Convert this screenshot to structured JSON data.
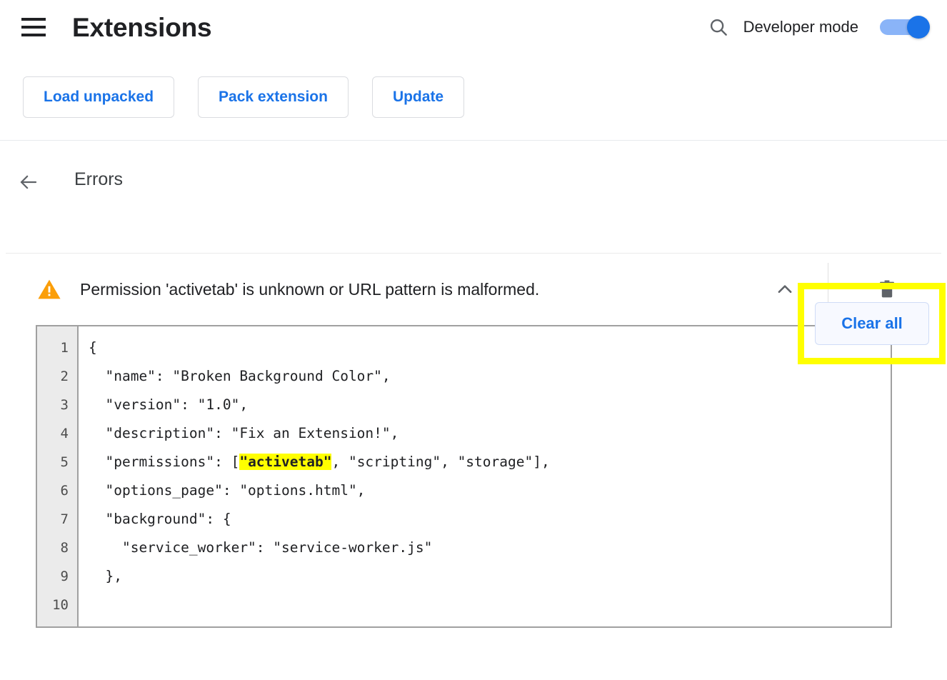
{
  "header": {
    "menu_icon": "hamburger-menu-icon",
    "title": "Extensions",
    "search_icon": "search-icon",
    "developer_mode_label": "Developer mode",
    "developer_mode_on": true
  },
  "toolbar": {
    "buttons": [
      {
        "label": "Load unpacked",
        "name": "load-unpacked-button"
      },
      {
        "label": "Pack extension",
        "name": "pack-extension-button"
      },
      {
        "label": "Update",
        "name": "update-button"
      }
    ]
  },
  "errors_page": {
    "back_icon": "arrow-left-icon",
    "title": "Errors",
    "clear_all_label": "Clear all",
    "highlight_color": "#ffff00"
  },
  "error_item": {
    "severity_icon": "warning-triangle-icon",
    "severity_color": "#f9a825",
    "message": "Permission 'activetab' is unknown or URL pattern is malformed.",
    "collapse_icon": "chevron-up-icon",
    "delete_icon": "trash-icon",
    "code": {
      "line_numbers": [
        "1",
        "2",
        "3",
        "4",
        "5",
        "6",
        "7",
        "8",
        "9",
        "10"
      ],
      "lines": [
        {
          "pre": "{",
          "highlight": "",
          "post": ""
        },
        {
          "pre": "  \"name\": \"Broken Background Color\",",
          "highlight": "",
          "post": ""
        },
        {
          "pre": "  \"version\": \"1.0\",",
          "highlight": "",
          "post": ""
        },
        {
          "pre": "  \"description\": \"Fix an Extension!\",",
          "highlight": "",
          "post": ""
        },
        {
          "pre": "  \"permissions\": [",
          "highlight": "\"activetab\"",
          "post": ", \"scripting\", \"storage\"],"
        },
        {
          "pre": "  \"options_page\": \"options.html\",",
          "highlight": "",
          "post": ""
        },
        {
          "pre": "  \"background\": {",
          "highlight": "",
          "post": ""
        },
        {
          "pre": "    \"service_worker\": \"service-worker.js\"",
          "highlight": "",
          "post": ""
        },
        {
          "pre": "  },",
          "highlight": "",
          "post": ""
        },
        {
          "pre": "",
          "highlight": "",
          "post": ""
        }
      ],
      "highlight_color": "#ffff00"
    }
  }
}
